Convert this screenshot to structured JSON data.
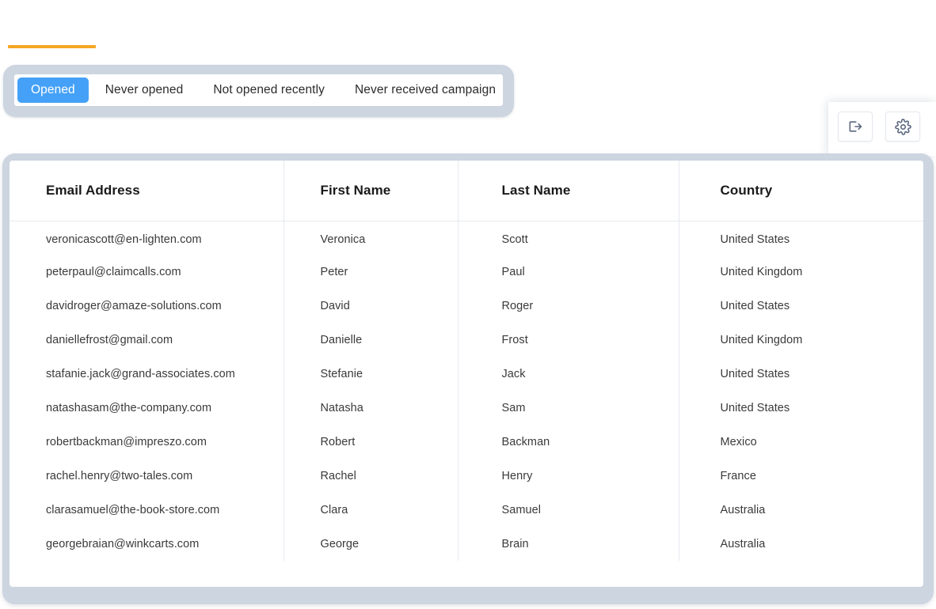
{
  "accent": {
    "color": "#f5a623"
  },
  "filters": {
    "active_index": 0,
    "active_color": "#45a1f7",
    "tabs": [
      {
        "label": "Opened"
      },
      {
        "label": "Never opened"
      },
      {
        "label": "Not opened recently"
      },
      {
        "label": "Never received campaign"
      }
    ]
  },
  "actions": {
    "buttons": [
      {
        "icon": "export-icon",
        "label": "Export"
      },
      {
        "icon": "gear-icon",
        "label": "Settings"
      }
    ]
  },
  "table": {
    "columns": [
      "Email Address",
      "First Name",
      "Last Name",
      "Country"
    ],
    "rows": [
      {
        "email": "veronicascott@en-lighten.com",
        "first": "Veronica",
        "last": "Scott",
        "country": "United States"
      },
      {
        "email": "peterpaul@claimcalls.com",
        "first": "Peter",
        "last": "Paul",
        "country": "United Kingdom"
      },
      {
        "email": "davidroger@amaze-solutions.com",
        "first": "David",
        "last": "Roger",
        "country": "United States"
      },
      {
        "email": "daniellefrost@gmail.com",
        "first": "Danielle",
        "last": "Frost",
        "country": "United Kingdom"
      },
      {
        "email": "stafanie.jack@grand-associates.com",
        "first": "Stefanie",
        "last": "Jack",
        "country": "United States"
      },
      {
        "email": "natashasam@the-company.com",
        "first": "Natasha",
        "last": "Sam",
        "country": "United States"
      },
      {
        "email": "robertbackman@impreszo.com",
        "first": "Robert",
        "last": "Backman",
        "country": "Mexico"
      },
      {
        "email": "rachel.henry@two-tales.com",
        "first": "Rachel",
        "last": "Henry",
        "country": "France"
      },
      {
        "email": "clarasamuel@the-book-store.com",
        "first": "Clara",
        "last": "Samuel",
        "country": "Australia"
      },
      {
        "email": "georgebraian@winkcarts.com",
        "first": "George",
        "last": "Brain",
        "country": "Australia"
      }
    ]
  }
}
